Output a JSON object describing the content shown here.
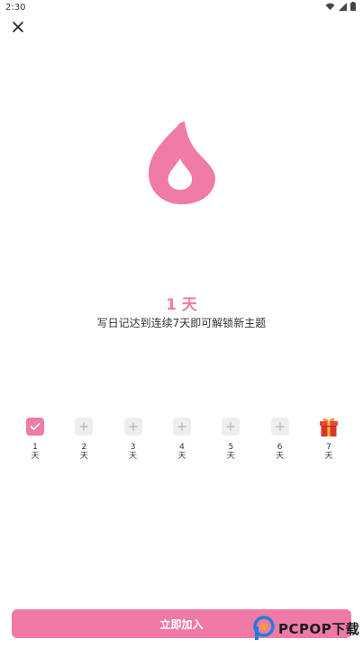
{
  "status_bar": {
    "time": "2:30"
  },
  "streak": {
    "count_text": "1 天"
  },
  "description": "写日记达到连续7天即可解锁新主题",
  "days": [
    {
      "num": "1",
      "unit": "天",
      "state": "done"
    },
    {
      "num": "2",
      "unit": "天",
      "state": "locked"
    },
    {
      "num": "3",
      "unit": "天",
      "state": "locked"
    },
    {
      "num": "4",
      "unit": "天",
      "state": "locked"
    },
    {
      "num": "5",
      "unit": "天",
      "state": "locked"
    },
    {
      "num": "6",
      "unit": "天",
      "state": "locked"
    },
    {
      "num": "7",
      "unit": "天",
      "state": "gift"
    }
  ],
  "join_button": {
    "label": "立即加入"
  },
  "watermark": {
    "text": "PCPOP下载"
  },
  "colors": {
    "accent": "#ef7ba6",
    "button": "#f07aa7",
    "locked_box": "#eeeeee"
  },
  "icons": {
    "close": "close-icon",
    "flame": "flame-icon",
    "check": "check-icon",
    "plus": "plus-icon",
    "gift": "gift-icon"
  }
}
